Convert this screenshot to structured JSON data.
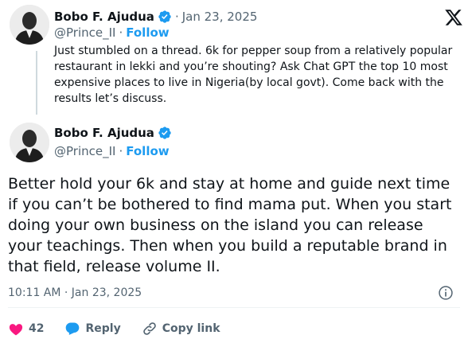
{
  "parent_tweet": {
    "author_name": "Bobo F. Ajudua",
    "date": "Jan 23, 2025",
    "handle": "@Prince_II",
    "follow_label": "Follow",
    "text": "Just stumbled on a thread. 6k for pepper soup from a relatively popular restaurant in lekki and you’re shouting? Ask Chat GPT the top 10 most expensive places to live in Nigeria(by local govt). Come back with the results let’s discuss."
  },
  "main_tweet": {
    "author_name": "Bobo F. Ajudua",
    "handle": "@Prince_II",
    "follow_label": "Follow",
    "text": "Better hold your 6k and stay at home and guide next time if you can’t be bothered to find mama put. When you start doing your own business on the island you can release your teachings. Then when you build a reputable brand in that field, release volume II.",
    "timestamp": "10:11 AM · Jan 23, 2025"
  },
  "actions": {
    "like_count": "42",
    "reply_label": "Reply",
    "copy_link_label": "Copy link"
  },
  "separators": {
    "dot": "·"
  },
  "icons": {
    "brand": "x-logo-icon",
    "verified": "verified-badge-icon",
    "info": "info-icon",
    "like": "heart-icon",
    "reply": "reply-bubble-icon",
    "copy": "link-icon"
  },
  "colors": {
    "accent": "#1d9bf0",
    "muted": "#536471",
    "text": "#0f1419",
    "heart": "#f91880"
  }
}
